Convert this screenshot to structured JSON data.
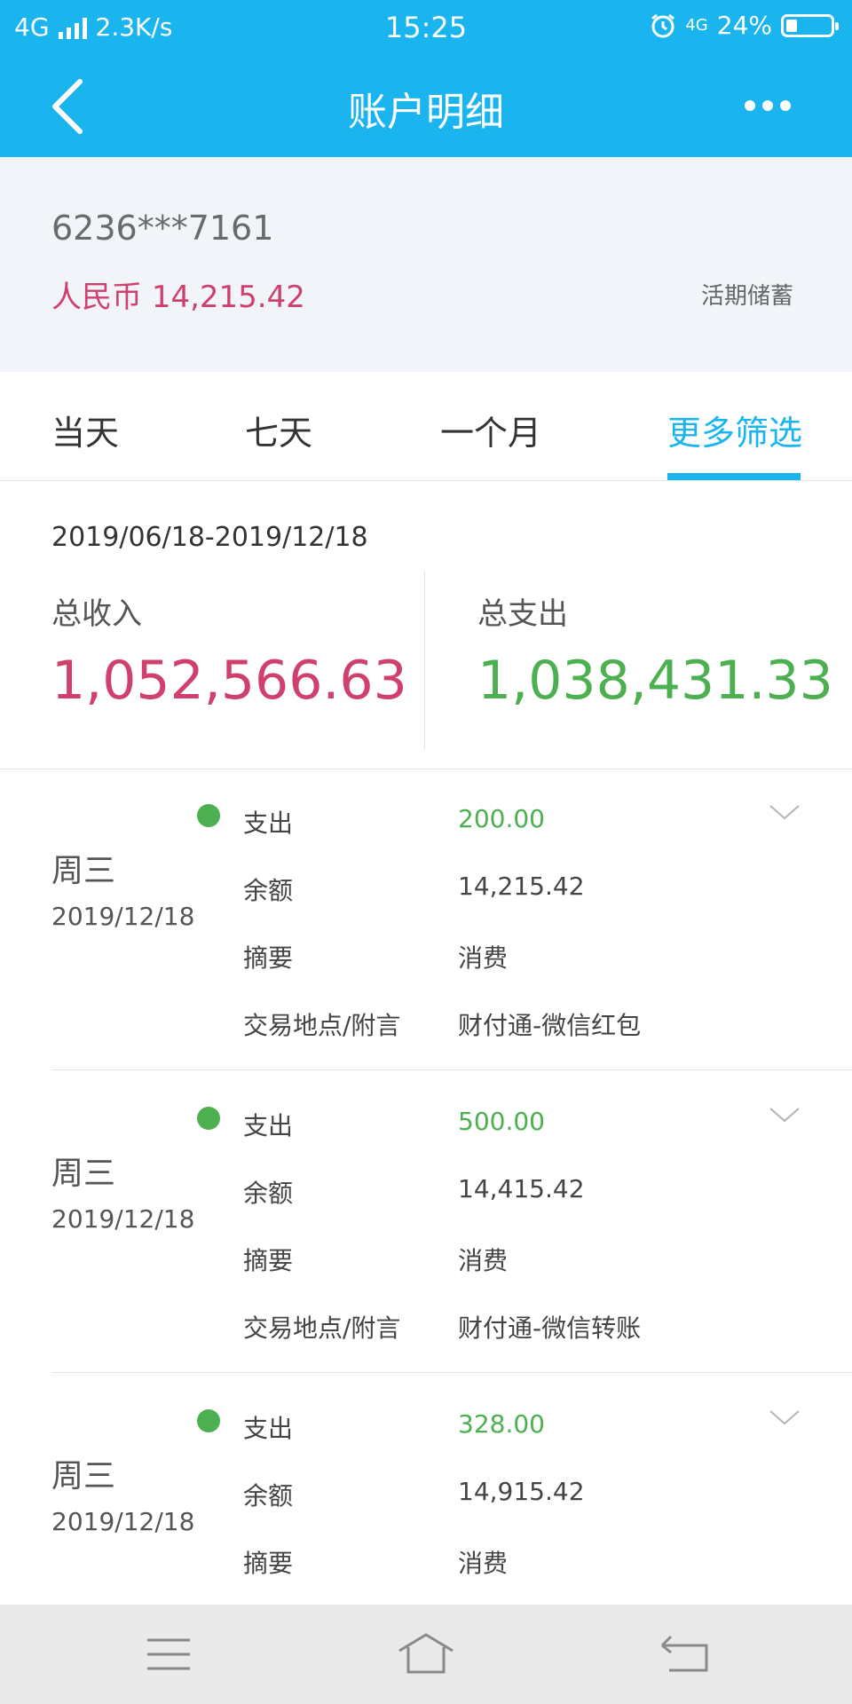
{
  "status_bar": {
    "network": "4G",
    "speed": "2.3K/s",
    "time": "15:25",
    "network_right": "4G",
    "battery": "24%",
    "battery_level": 0.24
  },
  "nav": {
    "title": "账户明细",
    "back_icon": "back-chevron-icon",
    "more_icon": "more-dots-icon"
  },
  "account": {
    "number": "6236***7161",
    "currency_label": "人民币",
    "balance": "14,215.42",
    "type": "活期储蓄"
  },
  "tabs": [
    {
      "label": "当天",
      "active": false
    },
    {
      "label": "七天",
      "active": false
    },
    {
      "label": "一个月",
      "active": false
    },
    {
      "label": "更多筛选",
      "active": true
    }
  ],
  "summary": {
    "date_range": "2019/06/18-2019/12/18",
    "income_label": "总收入",
    "income_value": "1,052,566.63",
    "expense_label": "总支出",
    "expense_value": "1,038,431.33"
  },
  "transactions": [
    {
      "day": "周三",
      "date": "2019/12/18",
      "type_label": "支出",
      "amount": "200.00",
      "balance_label": "余额",
      "balance": "14,215.42",
      "summary_label": "摘要",
      "summary": "消费",
      "place_label": "交易地点/附言",
      "place": "财付通-微信红包"
    },
    {
      "day": "周三",
      "date": "2019/12/18",
      "type_label": "支出",
      "amount": "500.00",
      "balance_label": "余额",
      "balance": "14,415.42",
      "summary_label": "摘要",
      "summary": "消费",
      "place_label": "交易地点/附言",
      "place": "财付通-微信转账"
    },
    {
      "day": "周三",
      "date": "2019/12/18",
      "type_label": "支出",
      "amount": "328.00",
      "balance_label": "余额",
      "balance": "14,915.42",
      "summary_label": "摘要",
      "summary": "消费"
    }
  ],
  "colors": {
    "brand": "#1ab4ef",
    "income": "#d0406c",
    "expense": "#4caf50"
  }
}
